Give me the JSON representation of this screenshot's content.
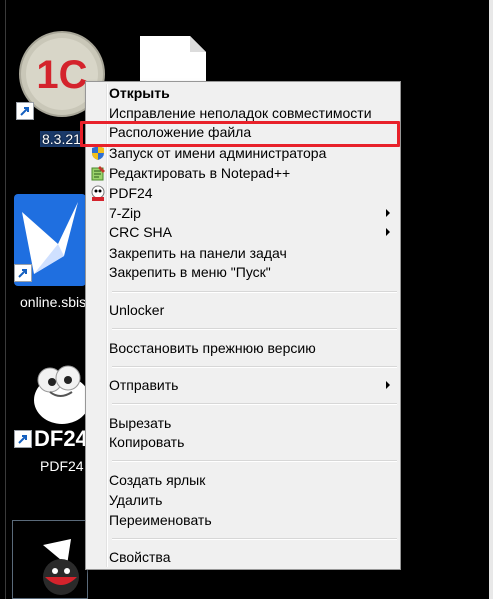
{
  "desktop": {
    "icons": [
      {
        "name": "1c-icon",
        "label": "8.3.21"
      },
      {
        "name": "file-icon",
        "label": ""
      },
      {
        "name": "sbis-icon",
        "label": "online.sbis"
      },
      {
        "name": "pdf24-icon",
        "label": "PDF24"
      },
      {
        "name": "java-icon",
        "label": ""
      }
    ]
  },
  "icons": {
    "logo_1c": "1С",
    "pdf24_logo": "DF24"
  },
  "colors": {
    "menu_bg": "#f0f0f0",
    "highlight": "#e8212a",
    "desktop_bg": "#000000"
  },
  "context_menu": {
    "open": "Открыть",
    "troubleshoot": "Исправление неполадок совместимости",
    "file_location": "Расположение файла",
    "run_as_admin": "Запуск от имени администратора",
    "edit_notepad": "Редактировать в Notepad++",
    "pdf24": "PDF24",
    "zip": "7-Zip",
    "crc": "CRC SHA",
    "pin_taskbar": "Закрепить на панели задач",
    "pin_start": "Закрепить в меню \"Пуск\"",
    "unlocker": "Unlocker",
    "restore": "Восстановить прежнюю версию",
    "send_to": "Отправить",
    "cut": "Вырезать",
    "copy": "Копировать",
    "create_shortcut": "Создать ярлык",
    "delete": "Удалить",
    "rename": "Переименовать",
    "properties": "Свойства"
  }
}
